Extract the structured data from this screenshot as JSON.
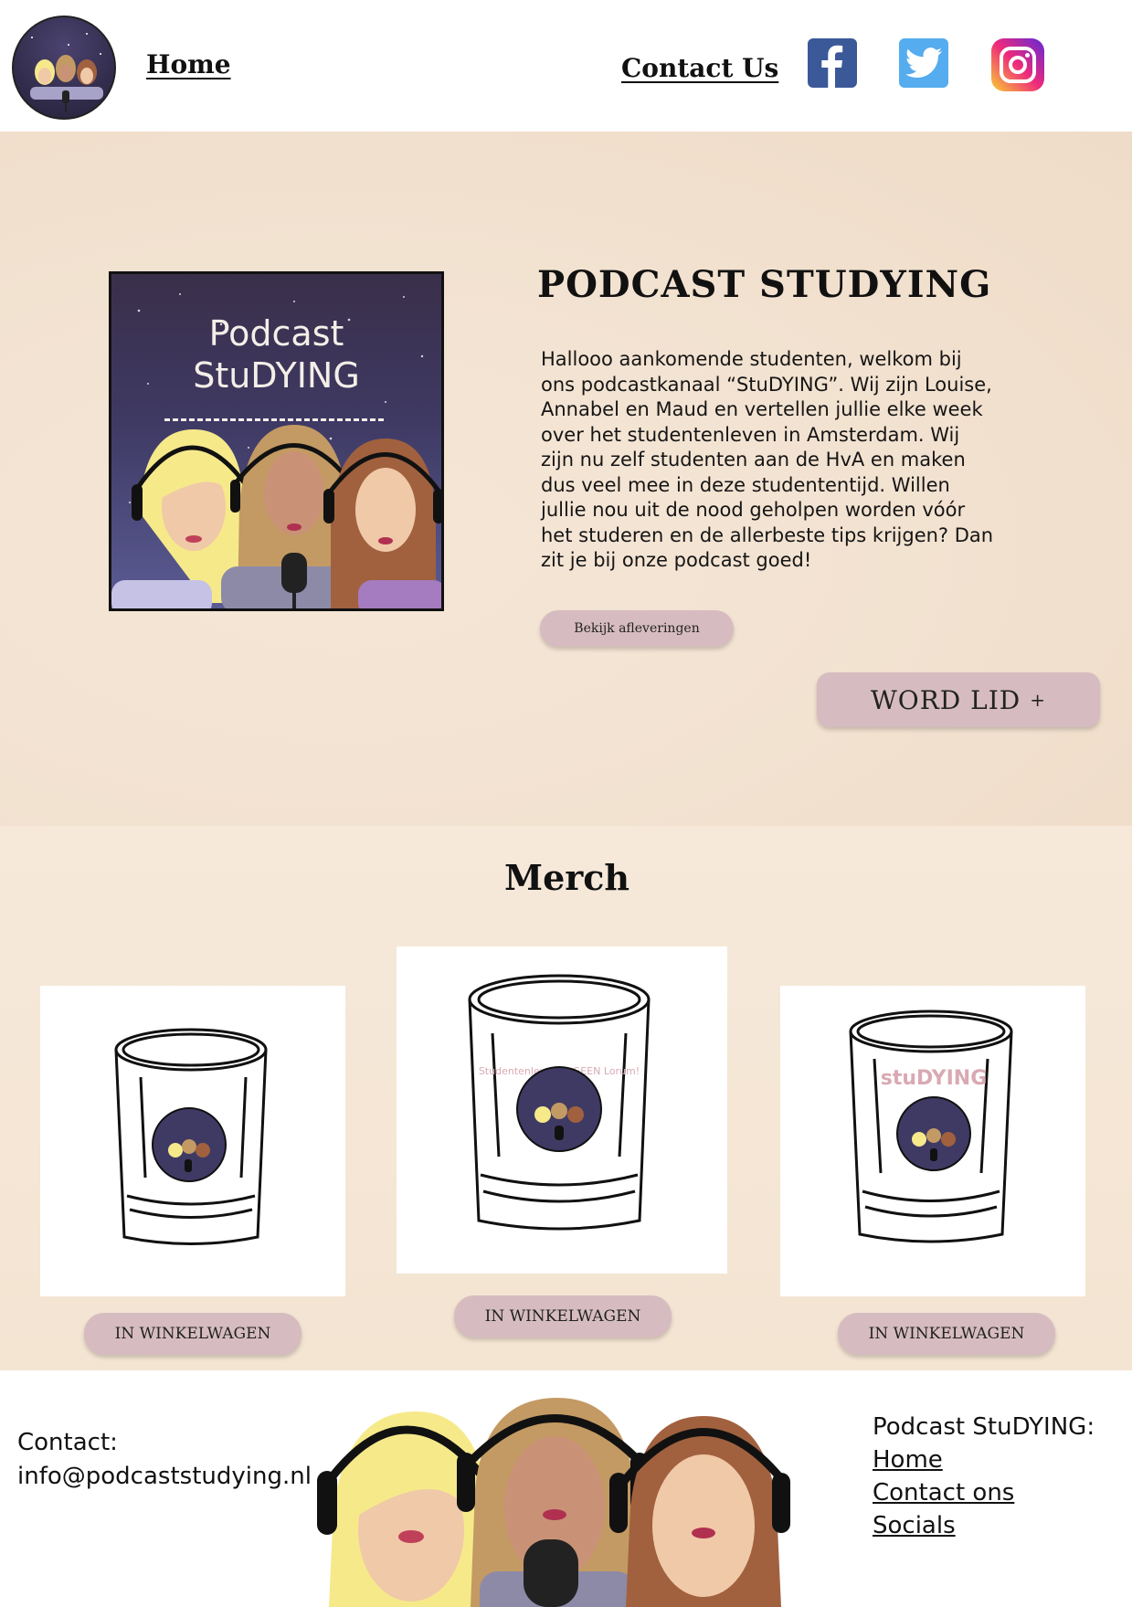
{
  "header": {
    "nav_home": "Home",
    "nav_contact": "Contact Us",
    "socials": [
      "facebook-icon",
      "twitter-icon",
      "instagram-icon"
    ]
  },
  "hero": {
    "cover_line1": "Podcast",
    "cover_line2": "StuDYING",
    "title": "PODCAST STUDYING",
    "text": "Hallooo aankomende studenten, welkom bij ons podcastkanaal “StuDYING”. Wij zijn Louise, Annabel en Maud en vertellen jullie elke week over het studentenleven in Amsterdam. Wij zijn nu zelf studenten aan de HvA en maken dus veel mee in deze studententijd. Willen jullie nou uit de nood geholpen worden vóór het studeren en de allerbeste tips krijgen? Dan zit je bij onze podcast goed!",
    "episodes_button": "Bekijk afleveringen",
    "join_button": "WORD LID",
    "join_plus": "+"
  },
  "merch": {
    "title": "Merch",
    "products": [
      {
        "print": ""
      },
      {
        "print": "Studentenleven is GEEN Lorum!"
      },
      {
        "print": "stuDYING"
      }
    ],
    "cart_label": "IN WINKELWAGEN"
  },
  "footer": {
    "contact_label": "Contact:",
    "contact_email": "info@podcaststudying.nl",
    "heading": "Podcast StuDYING:",
    "links": [
      "Home ",
      "Contact ons",
      "Socials"
    ]
  },
  "colors": {
    "background_beige": "#f3e3d2",
    "button_pink": "#d6bcc0",
    "cover_dark": "#3a2f4a",
    "facebook": "#3b5998",
    "twitter": "#55acee"
  }
}
